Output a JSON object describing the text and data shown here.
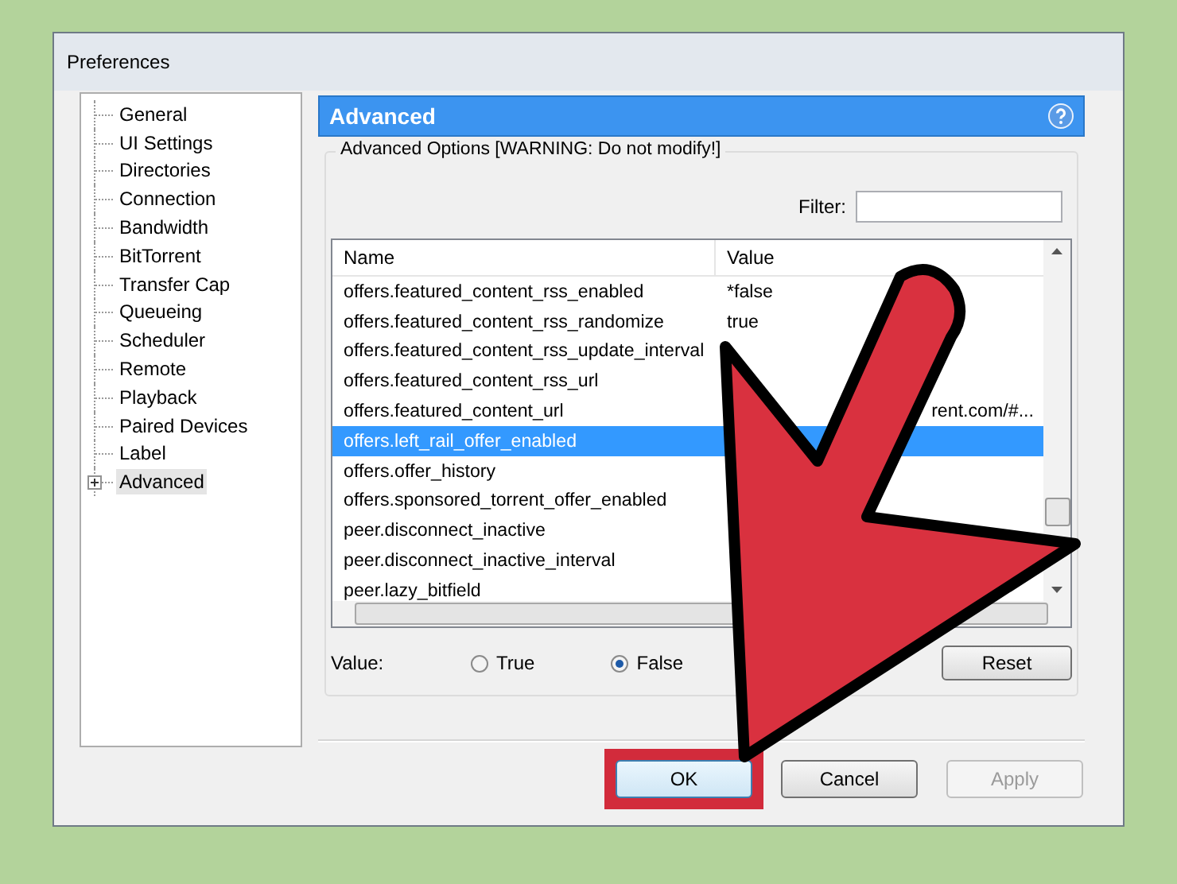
{
  "window": {
    "title": "Preferences"
  },
  "sidebar": {
    "items": [
      {
        "label": "General",
        "selected": false,
        "has_children": false
      },
      {
        "label": "UI Settings",
        "selected": false,
        "has_children": false
      },
      {
        "label": "Directories",
        "selected": false,
        "has_children": false
      },
      {
        "label": "Connection",
        "selected": false,
        "has_children": false
      },
      {
        "label": "Bandwidth",
        "selected": false,
        "has_children": false
      },
      {
        "label": "BitTorrent",
        "selected": false,
        "has_children": false
      },
      {
        "label": "Transfer Cap",
        "selected": false,
        "has_children": false
      },
      {
        "label": "Queueing",
        "selected": false,
        "has_children": false
      },
      {
        "label": "Scheduler",
        "selected": false,
        "has_children": false
      },
      {
        "label": "Remote",
        "selected": false,
        "has_children": false
      },
      {
        "label": "Playback",
        "selected": false,
        "has_children": false
      },
      {
        "label": "Paired Devices",
        "selected": false,
        "has_children": false
      },
      {
        "label": "Label",
        "selected": false,
        "has_children": false
      },
      {
        "label": "Advanced",
        "selected": true,
        "has_children": true
      }
    ]
  },
  "panel": {
    "title": "Advanced",
    "group_title": "Advanced Options [WARNING: Do not modify!]",
    "filter": {
      "label": "Filter:"
    },
    "table": {
      "columns": [
        "Name",
        "Value"
      ],
      "rows": [
        {
          "name": "offers.featured_content_rss_enabled",
          "value": "*false",
          "selected": false
        },
        {
          "name": "offers.featured_content_rss_randomize",
          "value": "true",
          "selected": false
        },
        {
          "name": "offers.featured_content_rss_update_interval",
          "selected": false
        },
        {
          "name": "offers.featured_content_rss_url",
          "selected": false
        },
        {
          "name": "offers.featured_content_url",
          "value": "rent.com/#...",
          "selected": false
        },
        {
          "name": "offers.left_rail_offer_enabled",
          "selected": true
        },
        {
          "name": "offers.offer_history",
          "selected": false
        },
        {
          "name": "offers.sponsored_torrent_offer_enabled",
          "selected": false
        },
        {
          "name": "peer.disconnect_inactive",
          "selected": false
        },
        {
          "name": "peer.disconnect_inactive_interval",
          "selected": false
        },
        {
          "name": "peer.lazy_bitfield",
          "selected": false
        }
      ]
    },
    "value_label": "Value:",
    "options": [
      {
        "label": "True",
        "selected": false
      },
      {
        "label": "False",
        "selected": true
      }
    ],
    "reset_button": "Reset"
  },
  "buttons": [
    {
      "label": "OK",
      "disabled": false,
      "highlighted": true
    },
    {
      "label": "Cancel",
      "disabled": false,
      "highlighted": false
    },
    {
      "label": "Apply",
      "disabled": true,
      "highlighted": false
    }
  ]
}
